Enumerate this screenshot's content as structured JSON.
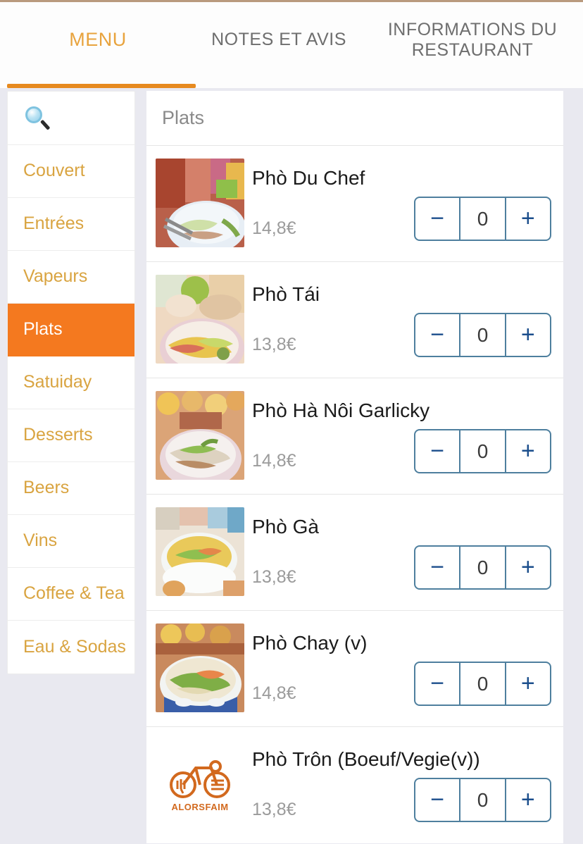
{
  "tabs": [
    {
      "label": "MENU",
      "active": true
    },
    {
      "label": "NOTES ET AVIS",
      "active": false
    },
    {
      "label": "INFORMATIONS DU RESTAURANT",
      "active": false
    }
  ],
  "sidebar": {
    "search_icon": "search-icon",
    "items": [
      {
        "label": "Couvert",
        "active": false
      },
      {
        "label": "Entrées",
        "active": false
      },
      {
        "label": "Vapeurs",
        "active": false
      },
      {
        "label": "Plats",
        "active": true
      },
      {
        "label": "Satuiday",
        "active": false
      },
      {
        "label": "Desserts",
        "active": false
      },
      {
        "label": "Beers",
        "active": false
      },
      {
        "label": "Vins",
        "active": false
      },
      {
        "label": "Coffee & Tea",
        "active": false
      },
      {
        "label": "Eau & Sodas",
        "active": false
      }
    ]
  },
  "main": {
    "section_title": "Plats",
    "stepper": {
      "minus_label": "−",
      "plus_label": "+"
    },
    "items": [
      {
        "name": "Phò Du Chef",
        "price": "14,8€",
        "quantity": "0",
        "image": "pho-bowl-photo"
      },
      {
        "name": "Phò Tái",
        "price": "13,8€",
        "quantity": "0",
        "image": "pho-bowl-photo"
      },
      {
        "name": "Phò Hà Nôi Garlicky",
        "price": "14,8€",
        "quantity": "0",
        "image": "pho-bowl-photo"
      },
      {
        "name": "Phò Gà",
        "price": "13,8€",
        "quantity": "0",
        "image": "pho-bowl-photo"
      },
      {
        "name": "Phò Chay (v)",
        "price": "14,8€",
        "quantity": "0",
        "image": "pho-bowl-photo"
      },
      {
        "name": "Phò Trôn (Boeuf/Vegie(v))",
        "price": "13,8€",
        "quantity": "0",
        "image": "alorsfaim-logo"
      }
    ]
  },
  "branding": {
    "logo_word": "ALORSFAIM",
    "accent_orange": "#f4791f",
    "tab_orange": "#e8a33d",
    "stepper_blue": "#4e7f9e",
    "glyph_blue": "#1b4e8c"
  }
}
